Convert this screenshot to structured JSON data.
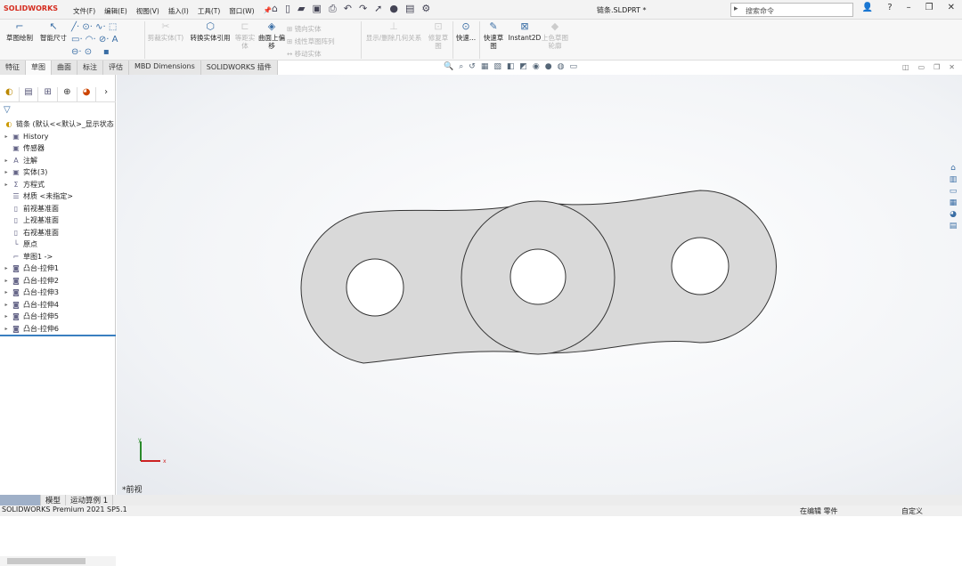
{
  "app": {
    "logo": "SOLIDWORKS",
    "title": "链条.SLDPRT *",
    "search_placeholder": "搜索命令"
  },
  "menu": [
    "文件(F)",
    "编辑(E)",
    "视图(V)",
    "插入(I)",
    "工具(T)",
    "窗口(W)"
  ],
  "toolbar": {
    "sketch": "草图绘制",
    "smart_dim": "智能尺寸",
    "trim": "剪裁实体(T)",
    "convert": "转换实体引用",
    "offset": "等距实体",
    "offset_surface": "曲面上偏移",
    "mirror": "镜向实体",
    "linear_pattern": "线性草图阵列",
    "move": "移动实体",
    "relations": "显示/删除几何关系",
    "repair": "修复草图",
    "quick_snaps": "快速...",
    "rapid_sketch": "快速草图",
    "instant2d": "Instant2D",
    "shaded_contours": "上色草图轮廓"
  },
  "tabs": [
    {
      "label": "特征"
    },
    {
      "label": "草图",
      "active": true
    },
    {
      "label": "曲面"
    },
    {
      "label": "标注"
    },
    {
      "label": "评估"
    },
    {
      "label": "MBD Dimensions"
    },
    {
      "label": "SOLIDWORKS 插件"
    }
  ],
  "tree": [
    {
      "label": "链条 (默认<<默认>_显示状态",
      "icon": "part-icon",
      "expand": false
    },
    {
      "label": "History",
      "icon": "history-icon",
      "expand": true
    },
    {
      "label": "传感器",
      "icon": "sensor-icon",
      "expand": false
    },
    {
      "label": "注解",
      "icon": "annotation-icon",
      "expand": true
    },
    {
      "label": "实体(3)",
      "icon": "solid-bodies-icon",
      "expand": true
    },
    {
      "label": "方程式",
      "icon": "equation-icon",
      "expand": true
    },
    {
      "label": "材质 <未指定>",
      "icon": "material-icon",
      "expand": false
    },
    {
      "label": "前视基准面",
      "icon": "plane-icon",
      "expand": false
    },
    {
      "label": "上视基准面",
      "icon": "plane-icon",
      "expand": false
    },
    {
      "label": "右视基准面",
      "icon": "plane-icon",
      "expand": false
    },
    {
      "label": "原点",
      "icon": "origin-icon",
      "expand": false
    },
    {
      "label": "草图1 ->",
      "icon": "sketch-icon",
      "expand": false
    },
    {
      "label": "凸台-拉伸1",
      "icon": "extrude-icon",
      "expand": true
    },
    {
      "label": "凸台-拉伸2",
      "icon": "extrude-icon",
      "expand": true
    },
    {
      "label": "凸台-拉伸3",
      "icon": "extrude-icon",
      "expand": true
    },
    {
      "label": "凸台-拉伸4",
      "icon": "extrude-icon",
      "expand": true
    },
    {
      "label": "凸台-拉伸5",
      "icon": "extrude-icon",
      "expand": true
    },
    {
      "label": "凸台-拉伸6",
      "icon": "extrude-icon",
      "expand": true
    }
  ],
  "viewport": {
    "view_name": "*前视",
    "axis_x": "x",
    "axis_y": "y",
    "part_fill": "#d9d9d9"
  },
  "bottom_tabs": [
    "模型",
    "运动算例 1"
  ],
  "status": {
    "version": "SOLIDWORKS Premium 2021 SP5.1",
    "mode": "在编辑 零件",
    "custom": "自定义"
  }
}
